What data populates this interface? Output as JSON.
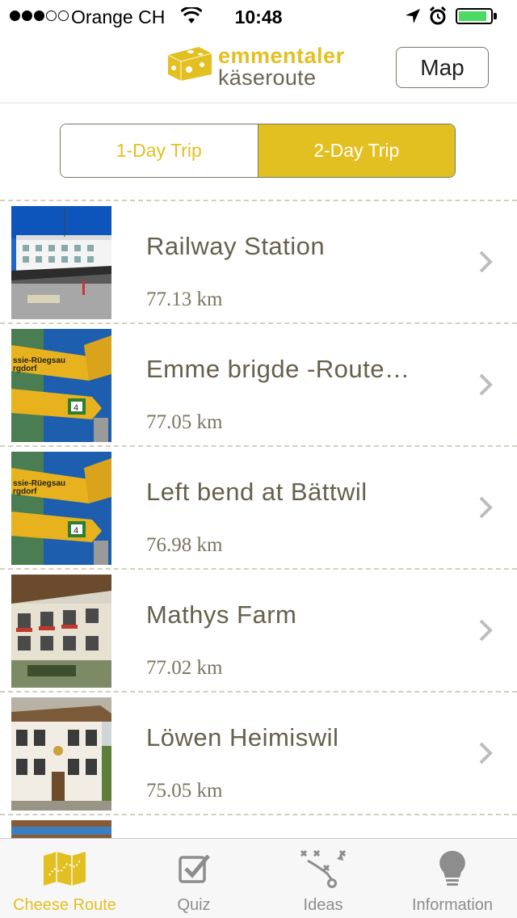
{
  "status_bar": {
    "carrier": "Orange CH",
    "time": "10:48",
    "signal_bars_filled": 3,
    "signal_bars_total": 5,
    "battery_level": 0.9
  },
  "header": {
    "logo_line1": "emmentaler",
    "logo_line2": "käseroute",
    "map_button": "Map"
  },
  "segments": [
    {
      "label": "1-Day Trip",
      "selected": false
    },
    {
      "label": "2-Day Trip",
      "selected": true
    }
  ],
  "stops": [
    {
      "title": "Railway Station",
      "distance": "77.13 km",
      "image": "station"
    },
    {
      "title": "Emme brigde -Route…",
      "distance": "77.05 km",
      "image": "signpost"
    },
    {
      "title": "Left bend at Bättwil",
      "distance": "76.98 km",
      "image": "signpost"
    },
    {
      "title": "Mathys Farm",
      "distance": "77.02 km",
      "image": "farmhouse"
    },
    {
      "title": "Löwen Heimiswil",
      "distance": "75.05 km",
      "image": "inn"
    }
  ],
  "tabs": [
    {
      "label": "Cheese Route",
      "icon": "map-icon",
      "active": true
    },
    {
      "label": "Quiz",
      "icon": "checkbox-icon",
      "active": false
    },
    {
      "label": "Ideas",
      "icon": "tactics-icon",
      "active": false
    },
    {
      "label": "Information",
      "icon": "lightbulb-icon",
      "active": false
    }
  ],
  "colors": {
    "brand_yellow": "#e3c021",
    "text_olive": "#66614d",
    "tab_inactive": "#8d8d8d"
  }
}
